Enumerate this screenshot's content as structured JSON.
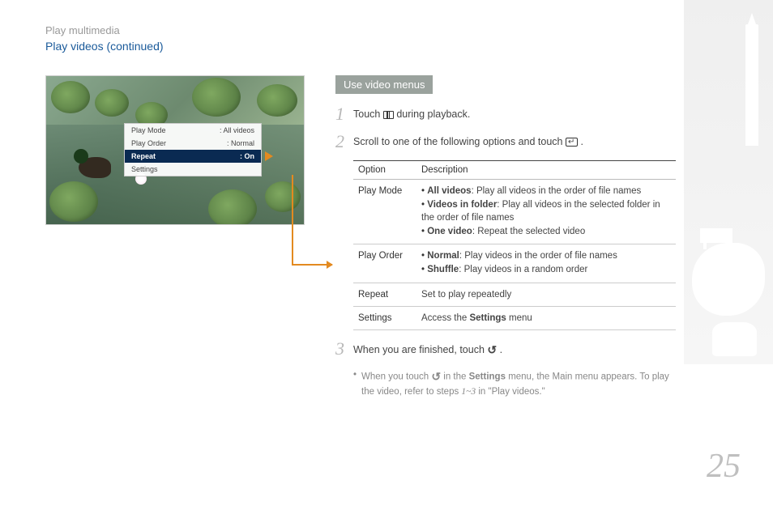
{
  "breadcrumb": "Play multimedia",
  "page_title": "Play videos  (continued)",
  "page_number": "25",
  "screenshot_menu": {
    "rows": [
      {
        "label": "Play Mode",
        "value": ": All videos"
      },
      {
        "label": "Play Order",
        "value": ": Normal"
      },
      {
        "label": "Repeat",
        "value": ": On"
      },
      {
        "label": "Settings",
        "value": ""
      }
    ],
    "highlighted_index": 2
  },
  "section_label": "Use video menus",
  "steps": {
    "s1": {
      "num": "1",
      "before": "Touch ",
      "after": " during playback."
    },
    "s2": {
      "num": "2",
      "before": "Scroll to one of the following options and touch ",
      "after": "."
    },
    "s3": {
      "num": "3",
      "before": "When you are finished, touch ",
      "after": ".",
      "note_pre": "When you touch ",
      "note_mid": " in the ",
      "note_bold": "Settings",
      "note_post1": " menu, the Main menu appears. To play the video, refer to steps ",
      "note_ital": "1~3",
      "note_post2": " in \"Play videos.\""
    }
  },
  "table": {
    "headers": {
      "option": "Option",
      "description": "Description"
    },
    "rows": [
      {
        "option": "Play Mode",
        "items": [
          {
            "bold": "All videos",
            "text": ": Play all videos in the order of file names"
          },
          {
            "bold": "Videos in folder",
            "text": ": Play all videos in the selected folder in the order of file names"
          },
          {
            "bold": "One video",
            "text": ": Repeat the selected video"
          }
        ]
      },
      {
        "option": "Play Order",
        "items": [
          {
            "bold": "Normal",
            "text": ": Play videos in the order of file names"
          },
          {
            "bold": "Shuffle",
            "text": ": Play videos in a random order"
          }
        ]
      },
      {
        "option": "Repeat",
        "plain": "Set to play repeatedly"
      },
      {
        "option": "Settings",
        "plain_pre": "Access the ",
        "plain_bold": "Settings",
        "plain_post": " menu"
      }
    ]
  }
}
